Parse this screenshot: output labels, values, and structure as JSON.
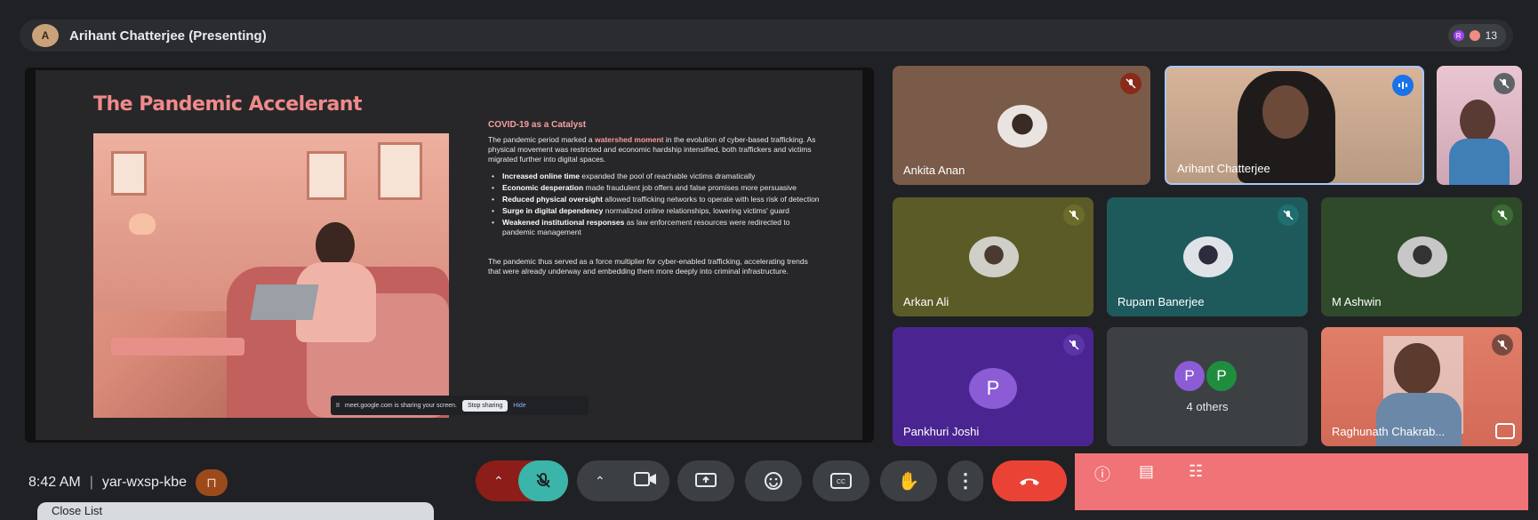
{
  "presenter": {
    "name": "Arihant Chatterjee (Presenting)",
    "participant_count": "13",
    "count_badge_letter": "R"
  },
  "slide": {
    "title": "The Pandemic Accelerant",
    "heading": "COVID-19 as a Catalyst",
    "intro_a": "The pandemic period marked a ",
    "intro_em": "watershed moment",
    "intro_b": " in the evolution of cyber-based trafficking. As physical movement was restricted and economic hardship intensified, both traffickers and victims migrated further into digital spaces.",
    "bullets": [
      {
        "bold": "Increased online time",
        "rest": " expanded the pool of reachable victims dramatically"
      },
      {
        "bold": "Economic desperation",
        "rest": " made fraudulent job offers and false promises more persuasive"
      },
      {
        "bold": "Reduced physical oversight",
        "rest": " allowed trafficking networks to operate with less risk of detection"
      },
      {
        "bold": "Surge in digital dependency",
        "rest": " normalized online relationships, lowering victims' guard"
      },
      {
        "bold": "Weakened institutional responses",
        "rest": " as law enforcement resources were redirected to pandemic management"
      }
    ],
    "closing": "The pandemic thus served as a force multiplier for cyber-enabled trafficking, accelerating trends that were already underway and embedding them more deeply into criminal infrastructure."
  },
  "share_bar": {
    "text": "meet.google.com is sharing your screen.",
    "stop": "Stop sharing",
    "hide": "Hide"
  },
  "tiles": [
    {
      "name": "Ankita Anan"
    },
    {
      "name": "Arihant Chatterjee"
    },
    {
      "name": "Arkan Ali"
    },
    {
      "name": "Rupam Banerjee"
    },
    {
      "name": "M Ashwin"
    },
    {
      "name": "Pankhuri Joshi",
      "letter": "P"
    },
    {
      "name": "4 others",
      "letters": [
        "P",
        "P"
      ]
    },
    {
      "name": "Raghunath Chakrab..."
    }
  ],
  "meeting": {
    "time": "8:42 AM",
    "code": "yar-wxsp-kbe"
  },
  "close_list": "Close List",
  "colors": {
    "accent_red": "#ea4335",
    "pink_panel": "#f07377",
    "teal_mic": "#3bb4a9"
  }
}
